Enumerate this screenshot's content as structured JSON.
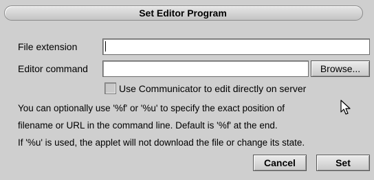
{
  "dialog": {
    "title": "Set Editor Program"
  },
  "form": {
    "file_extension_label": "File extension",
    "file_extension_value": "",
    "editor_command_label": "Editor command",
    "editor_command_value": "",
    "browse_label": "Browse...",
    "checkbox_label": "Use Communicator to edit directly on server",
    "checkbox_checked": false
  },
  "notes": {
    "line1": "You can optionally use '%f' or '%u' to specify the exact position of",
    "line2": "filename or URL in the command line.  Default is '%f' at the end.",
    "line3": "If '%u' is used, the applet will not download the file or change its state."
  },
  "buttons": {
    "cancel_label": "Cancel",
    "set_label": "Set"
  },
  "icons": {
    "pointer": "mouse-pointer-icon"
  }
}
